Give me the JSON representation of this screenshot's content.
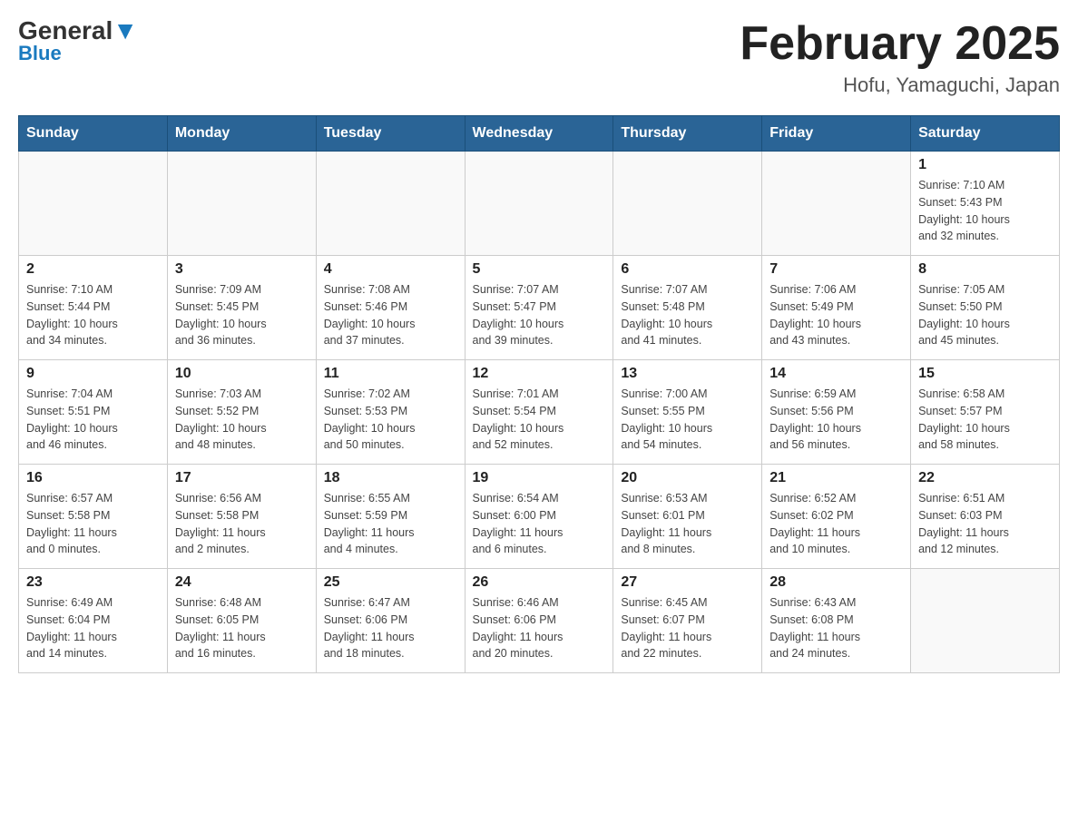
{
  "header": {
    "logo_general": "General",
    "logo_blue": "Blue",
    "month_year": "February 2025",
    "location": "Hofu, Yamaguchi, Japan"
  },
  "days_of_week": [
    "Sunday",
    "Monday",
    "Tuesday",
    "Wednesday",
    "Thursday",
    "Friday",
    "Saturday"
  ],
  "weeks": [
    {
      "days": [
        {
          "num": "",
          "info": ""
        },
        {
          "num": "",
          "info": ""
        },
        {
          "num": "",
          "info": ""
        },
        {
          "num": "",
          "info": ""
        },
        {
          "num": "",
          "info": ""
        },
        {
          "num": "",
          "info": ""
        },
        {
          "num": "1",
          "info": "Sunrise: 7:10 AM\nSunset: 5:43 PM\nDaylight: 10 hours\nand 32 minutes."
        }
      ]
    },
    {
      "days": [
        {
          "num": "2",
          "info": "Sunrise: 7:10 AM\nSunset: 5:44 PM\nDaylight: 10 hours\nand 34 minutes."
        },
        {
          "num": "3",
          "info": "Sunrise: 7:09 AM\nSunset: 5:45 PM\nDaylight: 10 hours\nand 36 minutes."
        },
        {
          "num": "4",
          "info": "Sunrise: 7:08 AM\nSunset: 5:46 PM\nDaylight: 10 hours\nand 37 minutes."
        },
        {
          "num": "5",
          "info": "Sunrise: 7:07 AM\nSunset: 5:47 PM\nDaylight: 10 hours\nand 39 minutes."
        },
        {
          "num": "6",
          "info": "Sunrise: 7:07 AM\nSunset: 5:48 PM\nDaylight: 10 hours\nand 41 minutes."
        },
        {
          "num": "7",
          "info": "Sunrise: 7:06 AM\nSunset: 5:49 PM\nDaylight: 10 hours\nand 43 minutes."
        },
        {
          "num": "8",
          "info": "Sunrise: 7:05 AM\nSunset: 5:50 PM\nDaylight: 10 hours\nand 45 minutes."
        }
      ]
    },
    {
      "days": [
        {
          "num": "9",
          "info": "Sunrise: 7:04 AM\nSunset: 5:51 PM\nDaylight: 10 hours\nand 46 minutes."
        },
        {
          "num": "10",
          "info": "Sunrise: 7:03 AM\nSunset: 5:52 PM\nDaylight: 10 hours\nand 48 minutes."
        },
        {
          "num": "11",
          "info": "Sunrise: 7:02 AM\nSunset: 5:53 PM\nDaylight: 10 hours\nand 50 minutes."
        },
        {
          "num": "12",
          "info": "Sunrise: 7:01 AM\nSunset: 5:54 PM\nDaylight: 10 hours\nand 52 minutes."
        },
        {
          "num": "13",
          "info": "Sunrise: 7:00 AM\nSunset: 5:55 PM\nDaylight: 10 hours\nand 54 minutes."
        },
        {
          "num": "14",
          "info": "Sunrise: 6:59 AM\nSunset: 5:56 PM\nDaylight: 10 hours\nand 56 minutes."
        },
        {
          "num": "15",
          "info": "Sunrise: 6:58 AM\nSunset: 5:57 PM\nDaylight: 10 hours\nand 58 minutes."
        }
      ]
    },
    {
      "days": [
        {
          "num": "16",
          "info": "Sunrise: 6:57 AM\nSunset: 5:58 PM\nDaylight: 11 hours\nand 0 minutes."
        },
        {
          "num": "17",
          "info": "Sunrise: 6:56 AM\nSunset: 5:58 PM\nDaylight: 11 hours\nand 2 minutes."
        },
        {
          "num": "18",
          "info": "Sunrise: 6:55 AM\nSunset: 5:59 PM\nDaylight: 11 hours\nand 4 minutes."
        },
        {
          "num": "19",
          "info": "Sunrise: 6:54 AM\nSunset: 6:00 PM\nDaylight: 11 hours\nand 6 minutes."
        },
        {
          "num": "20",
          "info": "Sunrise: 6:53 AM\nSunset: 6:01 PM\nDaylight: 11 hours\nand 8 minutes."
        },
        {
          "num": "21",
          "info": "Sunrise: 6:52 AM\nSunset: 6:02 PM\nDaylight: 11 hours\nand 10 minutes."
        },
        {
          "num": "22",
          "info": "Sunrise: 6:51 AM\nSunset: 6:03 PM\nDaylight: 11 hours\nand 12 minutes."
        }
      ]
    },
    {
      "days": [
        {
          "num": "23",
          "info": "Sunrise: 6:49 AM\nSunset: 6:04 PM\nDaylight: 11 hours\nand 14 minutes."
        },
        {
          "num": "24",
          "info": "Sunrise: 6:48 AM\nSunset: 6:05 PM\nDaylight: 11 hours\nand 16 minutes."
        },
        {
          "num": "25",
          "info": "Sunrise: 6:47 AM\nSunset: 6:06 PM\nDaylight: 11 hours\nand 18 minutes."
        },
        {
          "num": "26",
          "info": "Sunrise: 6:46 AM\nSunset: 6:06 PM\nDaylight: 11 hours\nand 20 minutes."
        },
        {
          "num": "27",
          "info": "Sunrise: 6:45 AM\nSunset: 6:07 PM\nDaylight: 11 hours\nand 22 minutes."
        },
        {
          "num": "28",
          "info": "Sunrise: 6:43 AM\nSunset: 6:08 PM\nDaylight: 11 hours\nand 24 minutes."
        },
        {
          "num": "",
          "info": ""
        }
      ]
    }
  ]
}
